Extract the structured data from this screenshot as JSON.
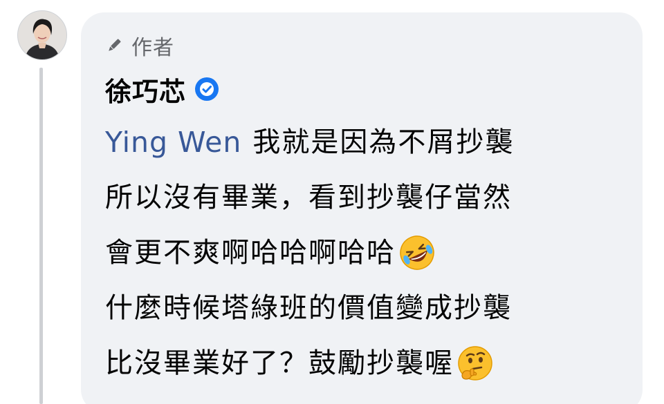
{
  "comment": {
    "author_badge": "作者",
    "author_name": "徐巧芯",
    "mention": "Ying Wen",
    "lines": [
      "我就是因為不屑抄襲",
      "所以沒有畢業，看到抄襲仔當然",
      "會更不爽啊哈哈啊哈哈",
      "什麼時候塔綠班的價值變成抄襲",
      "比沒畢業好了？鼓勵抄襲喔"
    ],
    "emojis": [
      "rolling-on-floor-laughing-emoji",
      "thinking-face-emoji"
    ]
  },
  "colors": {
    "bubble": "#f0f2f5",
    "mention": "#385898",
    "verified": "#1877f2",
    "muted_text": "#65676b",
    "thread_line": "#ced0d4"
  },
  "icons": {
    "badge": "pencil-icon",
    "verified": "verified-check-icon"
  }
}
